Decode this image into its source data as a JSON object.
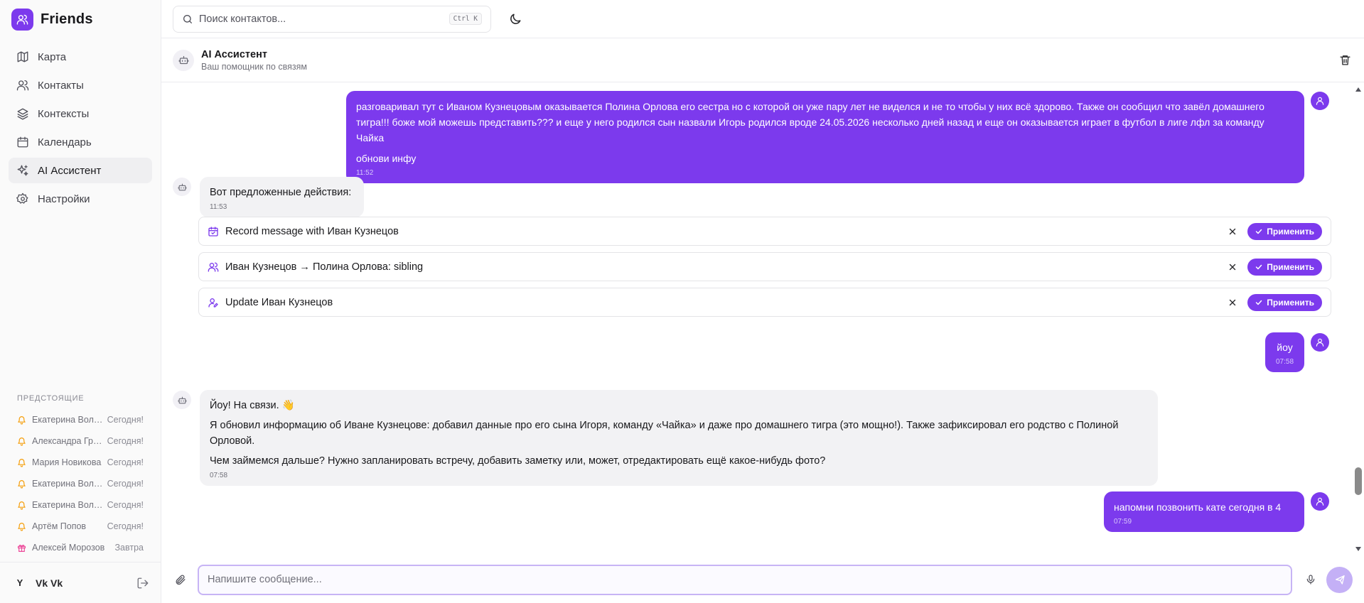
{
  "app": {
    "name": "Friends",
    "logo_icon": "users-icon",
    "accent": "#7c3aed"
  },
  "sidebar": {
    "items": [
      {
        "label": "Карта",
        "icon": "map-icon"
      },
      {
        "label": "Контакты",
        "icon": "users-icon"
      },
      {
        "label": "Контексты",
        "icon": "layers-icon"
      },
      {
        "label": "Календарь",
        "icon": "calendar-icon"
      },
      {
        "label": "AI Ассистент",
        "icon": "sparkles-icon",
        "active": true
      },
      {
        "label": "Настройки",
        "icon": "gear-icon"
      }
    ],
    "upcoming_title": "ПРЕДСТОЯЩИЕ",
    "upcoming": [
      {
        "name": "Екатерина Волкова",
        "when": "Сегодня!",
        "icon": "bell-icon"
      },
      {
        "name": "Александра Громова",
        "when": "Сегодня!",
        "icon": "bell-icon"
      },
      {
        "name": "Мария Новикова",
        "when": "Сегодня!",
        "icon": "bell-icon"
      },
      {
        "name": "Екатерина Волкова",
        "when": "Сегодня!",
        "icon": "bell-icon"
      },
      {
        "name": "Екатерина Волкова",
        "when": "Сегодня!",
        "icon": "bell-icon"
      },
      {
        "name": "Артём Попов",
        "when": "Сегодня!",
        "icon": "bell-icon"
      },
      {
        "name": "Алексей Морозов",
        "when": "Завтра",
        "icon": "gift-icon"
      }
    ],
    "user": {
      "initial": "Y",
      "name": "Vk Vk"
    }
  },
  "topbar": {
    "search_placeholder": "Поиск контактов...",
    "search_shortcut": "Ctrl K",
    "theme_icon": "moon-icon"
  },
  "chat": {
    "title": "AI Ассистент",
    "subtitle": "Ваш помощник по связям",
    "messages": [
      {
        "from": "user",
        "paragraphs": [
          "разговаривал тут с Иваном Кузнецовым оказывается Полина Орлова его сестра но с которой он уже пару лет не виделся и не то чтобы у них всё здорово. Также он сообщил что завёл домашнего тигра!!! боже мой можешь представить??? и еще у него родился сын назвали Игорь родился вроде 24.05.2026 несколько дней назад и еще он оказывается играет в футбол в лиге лфл за команду Чайка",
          "обнови инфу"
        ],
        "time": "11:52"
      },
      {
        "from": "bot",
        "paragraphs": [
          "Вот предложенные действия:"
        ],
        "time": "11:53"
      },
      {
        "from": "user",
        "paragraphs": [
          "йоу"
        ],
        "time": "07:58"
      },
      {
        "from": "bot",
        "paragraphs": [
          "Йоу! На связи. 👋",
          "Я обновил информацию об Иване Кузнецове: добавил данные про его сына Игоря, команду «Чайка» и даже про домашнего тигра (это мощно!). Также зафиксировал его родство с Полиной Орловой.",
          "Чем займемся дальше? Нужно запланировать встречу, добавить заметку или, может, отредактировать ещё какое-нибудь фото?"
        ],
        "time": "07:58"
      },
      {
        "from": "user",
        "paragraphs": [
          "напомни позвонить кате сегодня в 4"
        ],
        "time": "07:59"
      }
    ],
    "actions": [
      {
        "label": "Record message with Иван Кузнецов",
        "icon": "calendar-check-icon",
        "apply": "Применить"
      },
      {
        "label": "Иван Кузнецов → Полина Орлова: sibling",
        "icon": "users-icon",
        "apply": "Применить"
      },
      {
        "label": "Update Иван Кузнецов",
        "icon": "user-pen-icon",
        "apply": "Применить"
      }
    ]
  },
  "composer": {
    "placeholder": "Напишите сообщение..."
  }
}
